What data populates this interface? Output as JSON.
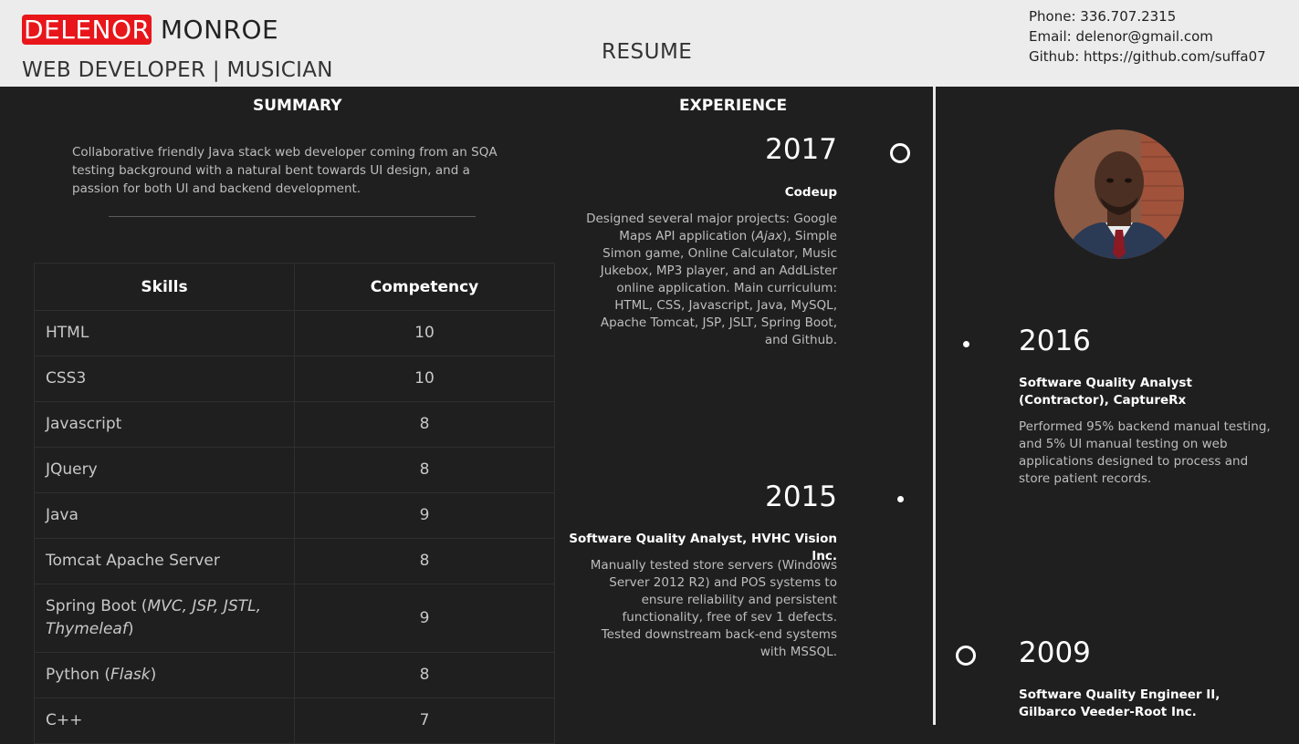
{
  "header": {
    "first_name": "DELENOR",
    "last_name": " MONROE",
    "tagline": "WEB DEVELOPER | MUSICIAN",
    "title": "RESUME",
    "phone": "Phone: 336.707.2315",
    "email": "Email: delenor@gmail.com",
    "github": "Github: https://github.com/suffa07"
  },
  "summary": {
    "heading": "SUMMARY",
    "text": "Collaborative friendly Java stack web developer coming from an SQA testing background with a natural bent towards UI design, and a passion for both UI and backend development."
  },
  "skills": {
    "col_skill": "Skills",
    "col_competency": "Competency",
    "rows": [
      {
        "skill": "HTML",
        "score": "10"
      },
      {
        "skill": "CSS3",
        "score": "10"
      },
      {
        "skill": "Javascript",
        "score": "8"
      },
      {
        "skill": "JQuery",
        "score": "8"
      },
      {
        "skill": "Java",
        "score": "9"
      },
      {
        "skill": "Tomcat Apache Server",
        "score": "8"
      },
      {
        "skill": "Spring Boot (",
        "skill_italic": "MVC, JSP, JSTL, Thymeleaf",
        "skill_tail": ")",
        "score": "9"
      },
      {
        "skill": "Python (",
        "skill_italic": "Flask",
        "skill_tail": ")",
        "score": "8"
      },
      {
        "skill": "C++",
        "score": "7"
      }
    ]
  },
  "experience": {
    "heading": "EXPERIENCE",
    "items": [
      {
        "year": "2017",
        "role": "Codeup",
        "desc_a": "Designed several major projects: Google Maps API application (",
        "desc_italic": "Ajax",
        "desc_b": "), Simple Simon game, Online Calculator, Music Jukebox, MP3 player, and an AddLister online application. Main curriculum: HTML, CSS, Javascript, Java, MySQL, Apache Tomcat, JSP, JSLT, Spring Boot, and Github."
      },
      {
        "year": "2016",
        "role": "Software Quality Analyst (Contractor), CaptureRx",
        "desc": "Performed 95% backend manual testing, and 5% UI manual testing on web applications designed to process and store patient records."
      },
      {
        "year": "2015",
        "role": "Software Quality Analyst, HVHC Vision Inc.",
        "desc": "Manually tested store servers (Windows Server 2012 R2) and POS systems to ensure reliability and persistent functionality, free of sev 1 defects. Tested downstream back-end systems with MSSQL."
      },
      {
        "year": "2009",
        "role": "Software Quality Engineer II, Gilbarco Veeder-Root Inc."
      }
    ]
  }
}
